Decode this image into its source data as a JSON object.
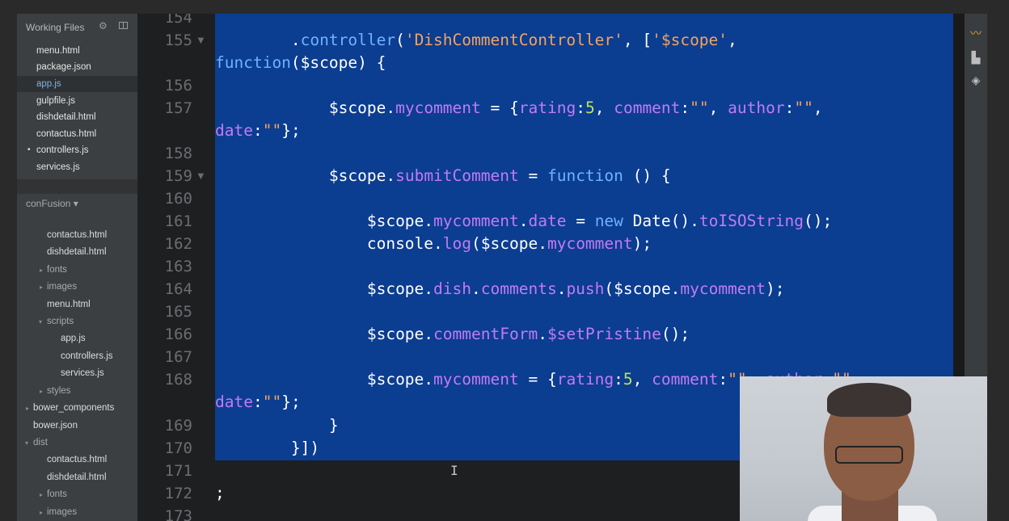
{
  "sidebar": {
    "working_files_title": "Working Files",
    "working_files": [
      {
        "name": "menu.html",
        "active": false,
        "dirty": false
      },
      {
        "name": "package.json",
        "active": false,
        "dirty": false
      },
      {
        "name": "app.js",
        "active": true,
        "dirty": false
      },
      {
        "name": "gulpfile.js",
        "active": false,
        "dirty": false
      },
      {
        "name": "dishdetail.html",
        "active": false,
        "dirty": false
      },
      {
        "name": "contactus.html",
        "active": false,
        "dirty": false
      },
      {
        "name": "controllers.js",
        "active": false,
        "dirty": true
      },
      {
        "name": "services.js",
        "active": false,
        "dirty": false
      }
    ],
    "project_name": "conFusion ▾",
    "tree": [
      {
        "label": "contactus.html",
        "type": "file",
        "depth": 2
      },
      {
        "label": "dishdetail.html",
        "type": "file",
        "depth": 2
      },
      {
        "label": "fonts",
        "type": "folder",
        "depth": 1
      },
      {
        "label": "images",
        "type": "folder",
        "depth": 1
      },
      {
        "label": "menu.html",
        "type": "file",
        "depth": 2
      },
      {
        "label": "scripts",
        "type": "folder-open",
        "depth": 1
      },
      {
        "label": "app.js",
        "type": "file",
        "depth": 3
      },
      {
        "label": "controllers.js",
        "type": "file",
        "depth": 3
      },
      {
        "label": "services.js",
        "type": "file",
        "depth": 3
      },
      {
        "label": "styles",
        "type": "folder",
        "depth": 1
      },
      {
        "label": "bower_components",
        "type": "folder",
        "depth": 0
      },
      {
        "label": "bower.json",
        "type": "file",
        "depth": 1
      },
      {
        "label": "dist",
        "type": "folder-open",
        "depth": 0
      },
      {
        "label": "contactus.html",
        "type": "file",
        "depth": 2
      },
      {
        "label": "dishdetail.html",
        "type": "file",
        "depth": 2
      },
      {
        "label": "fonts",
        "type": "folder",
        "depth": 1
      },
      {
        "label": "images",
        "type": "folder",
        "depth": 1
      }
    ]
  },
  "editor": {
    "line_numbers": [
      "154",
      "155",
      "156",
      "157",
      "158",
      "159",
      "160",
      "161",
      "162",
      "163",
      "164",
      "165",
      "166",
      "167",
      "168",
      "169",
      "170",
      "171",
      "172",
      "173"
    ],
    "lines": {
      "l155a": "        .controller('DishCommentController', ['$scope',",
      "l155b": "function($scope) {",
      "l157a": "            $scope.mycomment = {rating:5, comment:\"\", author:\"\",",
      "l157b": "date:\"\"};",
      "l159": "            $scope.submitComment = function () {",
      "l161": "                $scope.mycomment.date = new Date().toISOString();",
      "l162": "                console.log($scope.mycomment);",
      "l164": "                $scope.dish.comments.push($scope.mycomment);",
      "l166": "                $scope.commentForm.$setPristine();",
      "l168": "                $scope.mycomment = {rating:5, comment:\"\", author:\"\",",
      "l168b": "date:\"\"};",
      "l169": "            }",
      "l170": "        }])",
      "l172": ";"
    }
  },
  "colors": {
    "selection": "#0b3d91",
    "keyword": "#6fb3ff",
    "property": "#c37bf0",
    "string": "#f5a35c",
    "number": "#b9e35a"
  },
  "right_dock_icons": [
    "live-preview-icon",
    "extension-manager-icon",
    "layers-icon"
  ]
}
